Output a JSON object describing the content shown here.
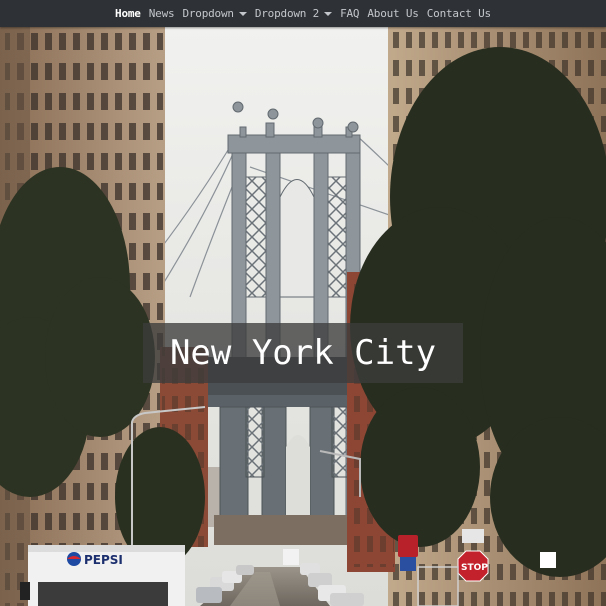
{
  "navbar": {
    "items": [
      {
        "label": "Home",
        "active": true,
        "dropdown": false
      },
      {
        "label": "News",
        "active": false,
        "dropdown": false
      },
      {
        "label": "Dropdown",
        "active": false,
        "dropdown": true
      },
      {
        "label": "Dropdown 2",
        "active": false,
        "dropdown": true
      },
      {
        "label": "FAQ",
        "active": false,
        "dropdown": false
      },
      {
        "label": "About Us",
        "active": false,
        "dropdown": false
      },
      {
        "label": "Contact Us",
        "active": false,
        "dropdown": false
      }
    ]
  },
  "hero": {
    "title": "New York City",
    "sign_stop": "STOP",
    "truck_brand": "PEPSI"
  },
  "colors": {
    "navbar_bg": "#2e3236",
    "nav_text": "#c3c7cb",
    "nav_active": "#ffffff",
    "title_overlay": "rgba(60,60,60,0.78)"
  }
}
